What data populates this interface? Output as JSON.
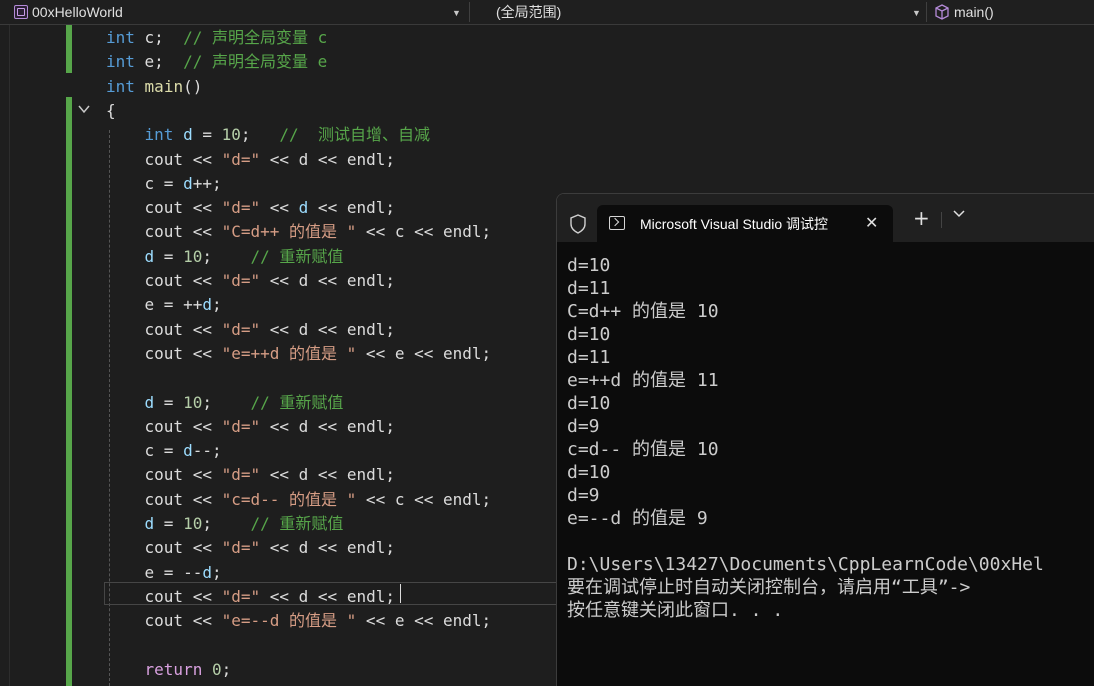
{
  "navbar": {
    "project": "00xHelloWorld",
    "scope": "(全局范围)",
    "member": "main()"
  },
  "code": {
    "lines": [
      {
        "tokens": [
          {
            "t": "int",
            "c": "kw"
          },
          {
            "t": " c;  ",
            "c": ""
          },
          {
            "t": "// 声明全局变量 c",
            "c": "cm"
          }
        ]
      },
      {
        "tokens": [
          {
            "t": "int",
            "c": "kw"
          },
          {
            "t": " e;  ",
            "c": ""
          },
          {
            "t": "// 声明全局变量 e",
            "c": "cm"
          }
        ]
      },
      {
        "tokens": [
          {
            "t": "int",
            "c": "kw"
          },
          {
            "t": " ",
            "c": ""
          },
          {
            "t": "main",
            "c": "fn"
          },
          {
            "t": "()",
            "c": ""
          }
        ]
      },
      {
        "tokens": [
          {
            "t": "{",
            "c": ""
          }
        ]
      },
      {
        "tokens": [
          {
            "t": "    ",
            "c": ""
          },
          {
            "t": "int",
            "c": "kw"
          },
          {
            "t": " ",
            "c": ""
          },
          {
            "t": "d",
            "c": "var"
          },
          {
            "t": " = ",
            "c": ""
          },
          {
            "t": "10",
            "c": "num"
          },
          {
            "t": ";   ",
            "c": ""
          },
          {
            "t": "//  测试自增、自减",
            "c": "cm"
          }
        ]
      },
      {
        "tokens": [
          {
            "t": "    cout << ",
            "c": ""
          },
          {
            "t": "\"d=\"",
            "c": "str"
          },
          {
            "t": " << d << endl;",
            "c": ""
          }
        ]
      },
      {
        "tokens": [
          {
            "t": "    c = ",
            "c": ""
          },
          {
            "t": "d",
            "c": "var"
          },
          {
            "t": "++;",
            "c": ""
          }
        ]
      },
      {
        "tokens": [
          {
            "t": "    cout << ",
            "c": ""
          },
          {
            "t": "\"d=\"",
            "c": "str"
          },
          {
            "t": " << ",
            "c": ""
          },
          {
            "t": "d",
            "c": "var"
          },
          {
            "t": " << endl;",
            "c": ""
          }
        ]
      },
      {
        "tokens": [
          {
            "t": "    cout << ",
            "c": ""
          },
          {
            "t": "\"C=d++ 的值是 \"",
            "c": "str"
          },
          {
            "t": " << c << endl;",
            "c": ""
          }
        ]
      },
      {
        "tokens": [
          {
            "t": "    ",
            "c": ""
          },
          {
            "t": "d",
            "c": "var"
          },
          {
            "t": " = ",
            "c": ""
          },
          {
            "t": "10",
            "c": "num"
          },
          {
            "t": ";    ",
            "c": ""
          },
          {
            "t": "// 重新赋值",
            "c": "cm"
          }
        ]
      },
      {
        "tokens": [
          {
            "t": "    cout << ",
            "c": ""
          },
          {
            "t": "\"d=\"",
            "c": "str"
          },
          {
            "t": " << d << endl;",
            "c": ""
          }
        ]
      },
      {
        "tokens": [
          {
            "t": "    e = ++",
            "c": ""
          },
          {
            "t": "d",
            "c": "var"
          },
          {
            "t": ";",
            "c": ""
          }
        ]
      },
      {
        "tokens": [
          {
            "t": "    cout << ",
            "c": ""
          },
          {
            "t": "\"d=\"",
            "c": "str"
          },
          {
            "t": " << d << endl;",
            "c": ""
          }
        ]
      },
      {
        "tokens": [
          {
            "t": "    cout << ",
            "c": ""
          },
          {
            "t": "\"e=++d 的值是 \"",
            "c": "str"
          },
          {
            "t": " << e << endl;",
            "c": ""
          }
        ]
      },
      {
        "tokens": [
          {
            "t": "",
            "c": ""
          }
        ]
      },
      {
        "tokens": [
          {
            "t": "    ",
            "c": ""
          },
          {
            "t": "d",
            "c": "var"
          },
          {
            "t": " = ",
            "c": ""
          },
          {
            "t": "10",
            "c": "num"
          },
          {
            "t": ";    ",
            "c": ""
          },
          {
            "t": "// 重新赋值",
            "c": "cm"
          }
        ]
      },
      {
        "tokens": [
          {
            "t": "    cout << ",
            "c": ""
          },
          {
            "t": "\"d=\"",
            "c": "str"
          },
          {
            "t": " << d << endl;",
            "c": ""
          }
        ]
      },
      {
        "tokens": [
          {
            "t": "    c = ",
            "c": ""
          },
          {
            "t": "d",
            "c": "var"
          },
          {
            "t": "--;",
            "c": ""
          }
        ]
      },
      {
        "tokens": [
          {
            "t": "    cout << ",
            "c": ""
          },
          {
            "t": "\"d=\"",
            "c": "str"
          },
          {
            "t": " << d << endl;",
            "c": ""
          }
        ]
      },
      {
        "tokens": [
          {
            "t": "    cout << ",
            "c": ""
          },
          {
            "t": "\"c=d-- 的值是 \"",
            "c": "str"
          },
          {
            "t": " << c << endl;",
            "c": ""
          }
        ]
      },
      {
        "tokens": [
          {
            "t": "    ",
            "c": ""
          },
          {
            "t": "d",
            "c": "var"
          },
          {
            "t": " = ",
            "c": ""
          },
          {
            "t": "10",
            "c": "num"
          },
          {
            "t": ";    ",
            "c": ""
          },
          {
            "t": "// 重新赋值",
            "c": "cm"
          }
        ]
      },
      {
        "tokens": [
          {
            "t": "    cout << ",
            "c": ""
          },
          {
            "t": "\"d=\"",
            "c": "str"
          },
          {
            "t": " << d << endl;",
            "c": ""
          }
        ]
      },
      {
        "tokens": [
          {
            "t": "    e = --",
            "c": ""
          },
          {
            "t": "d",
            "c": "var"
          },
          {
            "t": ";",
            "c": ""
          }
        ]
      },
      {
        "tokens": [
          {
            "t": "    cout << ",
            "c": ""
          },
          {
            "t": "\"d=\"",
            "c": "str"
          },
          {
            "t": " << d << endl;",
            "c": ""
          }
        ]
      },
      {
        "tokens": [
          {
            "t": "    cout << ",
            "c": ""
          },
          {
            "t": "\"e=--d 的值是 \"",
            "c": "str"
          },
          {
            "t": " << e << endl;",
            "c": ""
          }
        ]
      },
      {
        "tokens": [
          {
            "t": "",
            "c": ""
          }
        ]
      },
      {
        "tokens": [
          {
            "t": "    ",
            "c": ""
          },
          {
            "t": "return",
            "c": "kwc"
          },
          {
            "t": " ",
            "c": ""
          },
          {
            "t": "0",
            "c": "num"
          },
          {
            "t": ";",
            "c": ""
          }
        ]
      }
    ]
  },
  "console": {
    "tab_title": "Microsoft Visual Studio 调试控",
    "output": [
      "d=10",
      "d=11",
      "C=d++ 的值是 10",
      "d=10",
      "d=11",
      "e=++d 的值是 11",
      "d=10",
      "d=9",
      "c=d-- 的值是 10",
      "d=10",
      "d=9",
      "e=--d 的值是 9",
      "",
      "D:\\Users\\13427\\Documents\\CppLearnCode\\00xHel",
      "要在调试停止时自动关闭控制台，请启用“工具”->",
      "按任意键关闭此窗口. . ."
    ]
  },
  "colors": {
    "keyword": "#569cd6",
    "comment": "#57a64a",
    "string": "#d69d85",
    "number": "#b5cea8",
    "change_bar": "#57a64a"
  }
}
